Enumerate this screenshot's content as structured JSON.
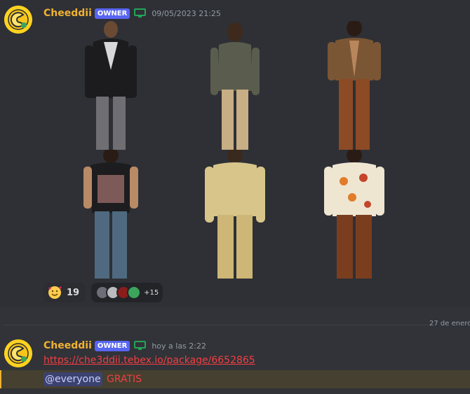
{
  "messages": [
    {
      "username": "Cheeddii",
      "badge": "OWNER",
      "timestamp": "09/05/2023 21:25",
      "reactions": {
        "emoji_icon": "smiling-face-with-hearts-icon",
        "count": "19",
        "more_count": "+15"
      }
    },
    {
      "username": "Cheeddii",
      "badge": "OWNER",
      "timestamp": "hoy a las 2:22",
      "link": "https://che3ddii.tebex.io/package/6652865",
      "mention": "@everyone",
      "text": "GRATIS"
    }
  ],
  "divider": {
    "date": "27 de enero"
  },
  "colors": {
    "username": "#f0b232",
    "owner_badge": "#5865f2",
    "link": "#f23f42",
    "mention_highlight": "#45402f"
  }
}
